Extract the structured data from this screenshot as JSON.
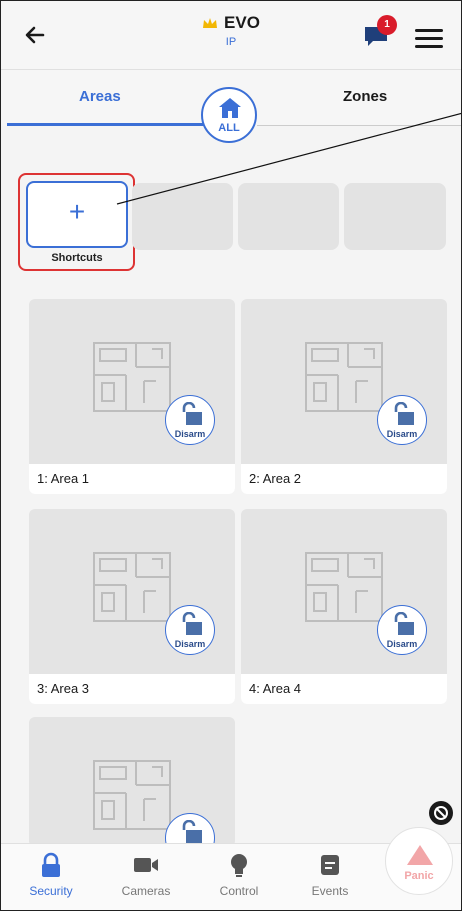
{
  "header": {
    "title": "EVO",
    "subtitle": "IP",
    "notification_count": "1"
  },
  "tabs": {
    "left": "Areas",
    "right": "Zones",
    "all_label": "ALL"
  },
  "shortcuts": {
    "add_symbol": "+",
    "label": "Shortcuts"
  },
  "areas": [
    {
      "name": "1: Area 1",
      "action": "Disarm"
    },
    {
      "name": "2: Area 2",
      "action": "Disarm"
    },
    {
      "name": "3: Area 3",
      "action": "Disarm"
    },
    {
      "name": "4: Area 4",
      "action": "Disarm"
    }
  ],
  "nav": {
    "security": "Security",
    "cameras": "Cameras",
    "control": "Control",
    "events": "Events",
    "panic": "Panic"
  },
  "colors": {
    "accent": "#3b6fd6",
    "highlight": "#dd3333",
    "badge": "#d91c2b"
  }
}
